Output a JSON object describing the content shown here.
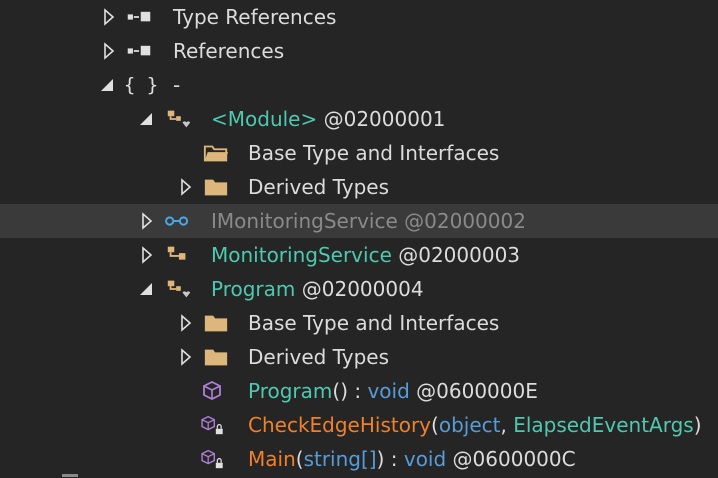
{
  "tree": {
    "type_references": "Type References",
    "references": "References",
    "namespace": "-",
    "module": {
      "name": "<Module>",
      "token": "@02000001"
    },
    "base_type_1": "Base Type and Interfaces",
    "derived_types_1": "Derived Types",
    "imonitoring": {
      "name": "IMonitoringService",
      "token": "@02000002"
    },
    "monitoring": {
      "name": "MonitoringService",
      "token": "@02000003"
    },
    "program": {
      "name": "Program",
      "token": "@02000004"
    },
    "base_type_2": "Base Type and Interfaces",
    "derived_types_2": "Derived Types",
    "ctor": {
      "name": "Program",
      "parens": "()",
      "sep": " : ",
      "ret": "void",
      "token": " @0600000E"
    },
    "check": {
      "name": "CheckEdgeHistory",
      "open": "(",
      "arg1": "object",
      "comma": ", ",
      "arg2": "ElapsedEventArgs",
      "close": ")"
    },
    "main": {
      "name": "Main",
      "open": "(",
      "arg1": "string[]",
      "close": ")",
      "sep": " : ",
      "ret": "void",
      "token": " @0600000C"
    }
  },
  "colors": {
    "background": "#252526",
    "selected_row": "#3a3a3a",
    "type_teal": "#4ec9b0",
    "method_orange": "#f0802a",
    "keyword_blue": "#569cd6",
    "folder": "#dcb67a"
  },
  "icons": {
    "reference": "references-icon",
    "namespace": "namespace-braces-icon",
    "class": "class-icon",
    "interface": "interface-icon",
    "folder": "folder-icon",
    "folder_open": "folder-open-icon",
    "method": "method-cube-icon",
    "private": "lock-icon"
  }
}
